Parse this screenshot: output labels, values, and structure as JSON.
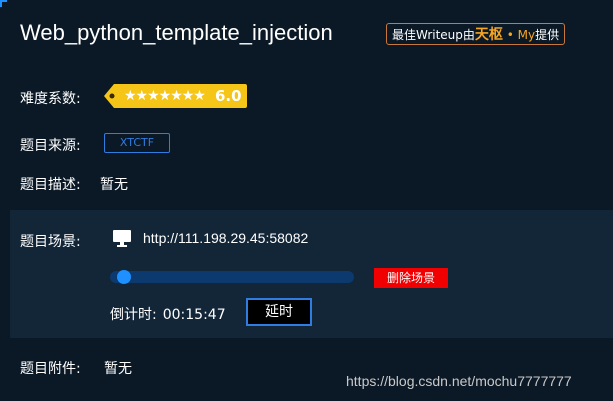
{
  "challenge": {
    "title": "Web_python_template_injection"
  },
  "writeup_badge": {
    "prefix": "最佳Writeup由",
    "author": "天枢",
    "separator": "•",
    "sub_author": "My",
    "suffix": "提供"
  },
  "difficulty": {
    "label": "难度系数:",
    "stars_text": "★★★★★★★",
    "star_count": 7,
    "rating": "6.0",
    "tag_color": "#f5c518"
  },
  "source": {
    "label": "题目来源:",
    "value": "XTCTF"
  },
  "description": {
    "label": "题目描述:",
    "value": "暂无"
  },
  "scene": {
    "label": "题目场景:",
    "icon": "monitor-icon",
    "url": "http://111.198.29.45:58082",
    "progress": 0.03,
    "delete_label": "删除场景",
    "countdown_label": "倒计时:",
    "countdown_value": "00:15:47",
    "extend_label": "延时"
  },
  "attachment": {
    "label": "题目附件:",
    "value": "暂无"
  },
  "watermark": "https://blog.csdn.net/mochu7777777",
  "colors": {
    "background": "#0b1826",
    "panel": "#132638",
    "accent": "#2f7de0",
    "danger": "#f00000",
    "badge_orange": "#f5a623"
  }
}
